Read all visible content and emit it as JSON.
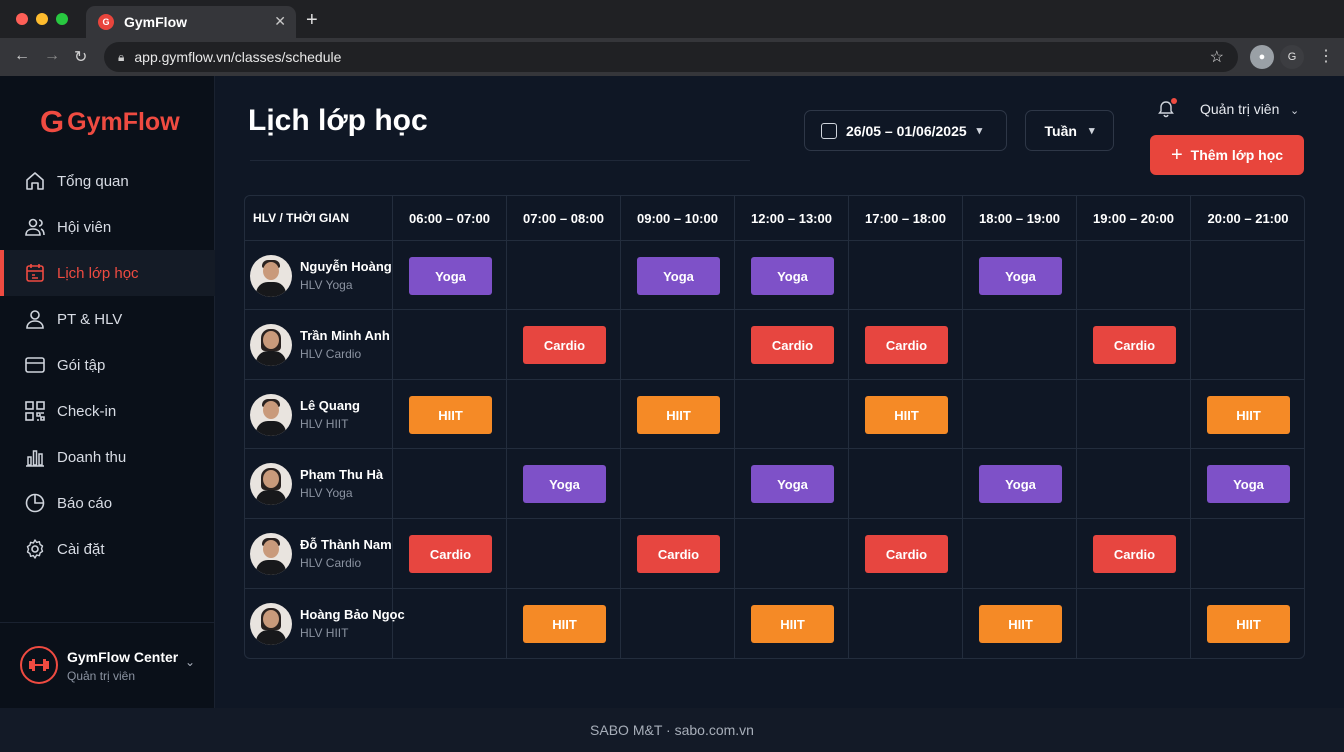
{
  "browser": {
    "tab_title": "GymFlow",
    "url": "app.gymflow.vn/classes/schedule",
    "profile_letter": "G"
  },
  "sidebar": {
    "brand_letter": "G",
    "brand": "GymFlow",
    "items": [
      {
        "label": "Tổng quan",
        "icon": "home-icon"
      },
      {
        "label": "Hội viên",
        "icon": "users-icon"
      },
      {
        "label": "Lịch lớp học",
        "icon": "calendar-icon",
        "active": true
      },
      {
        "label": "PT & HLV",
        "icon": "user-icon"
      },
      {
        "label": "Gói tập",
        "icon": "card-icon"
      },
      {
        "label": "Check-in",
        "icon": "qr-icon"
      },
      {
        "label": "Doanh thu",
        "icon": "bar-chart-icon"
      },
      {
        "label": "Báo cáo",
        "icon": "pie-chart-icon"
      },
      {
        "label": "Cài đặt",
        "icon": "gear-icon"
      }
    ],
    "footer": {
      "name": "GymFlow Center",
      "role": "Quản trị viên"
    }
  },
  "header": {
    "title": "Lịch lớp học",
    "date_range": "26/05 – 01/06/2025",
    "view_mode": "Tuần",
    "user": "Quản trị viên",
    "add_button": "Thêm lớp học"
  },
  "schedule": {
    "corner_label": "HLV / THỜI GIAN",
    "time_slots": [
      "06:00 – 07:00",
      "07:00 – 08:00",
      "09:00 – 10:00",
      "12:00 – 13:00",
      "17:00 – 18:00",
      "18:00 – 19:00",
      "19:00 – 20:00",
      "20:00 – 21:00"
    ],
    "trainers": [
      {
        "name": "Nguyễn Hoàng",
        "role": "HLV Yoga",
        "gender": "m",
        "classes": [
          "Yoga",
          "",
          "Yoga",
          "Yoga",
          "",
          "Yoga",
          "",
          ""
        ]
      },
      {
        "name": "Trần Minh Anh",
        "role": "HLV Cardio",
        "gender": "f",
        "classes": [
          "",
          "Cardio",
          "",
          "Cardio",
          "Cardio",
          "",
          "Cardio",
          ""
        ]
      },
      {
        "name": "Lê Quang",
        "role": "HLV HIIT",
        "gender": "m",
        "classes": [
          "HIIT",
          "",
          "HIIT",
          "",
          "HIIT",
          "",
          "",
          "HIIT"
        ]
      },
      {
        "name": "Phạm Thu Hà",
        "role": "HLV Yoga",
        "gender": "f",
        "classes": [
          "",
          "Yoga",
          "",
          "Yoga",
          "",
          "Yoga",
          "",
          "Yoga"
        ]
      },
      {
        "name": "Đỗ Thành Nam",
        "role": "HLV Cardio",
        "gender": "m",
        "classes": [
          "Cardio",
          "",
          "Cardio",
          "",
          "Cardio",
          "",
          "Cardio",
          ""
        ]
      },
      {
        "name": "Hoàng Bảo Ngọc",
        "role": "HLV HIIT",
        "gender": "f",
        "classes": [
          "",
          "HIIT",
          "",
          "HIIT",
          "",
          "HIIT",
          "",
          "HIIT"
        ]
      }
    ]
  },
  "colors": {
    "yoga": "#7e51c8",
    "cardio": "#e74640",
    "hiit": "#f58a26",
    "accent": "#ef4b41"
  },
  "footer": {
    "text": "SABO M&T · sabo.com.vn"
  }
}
